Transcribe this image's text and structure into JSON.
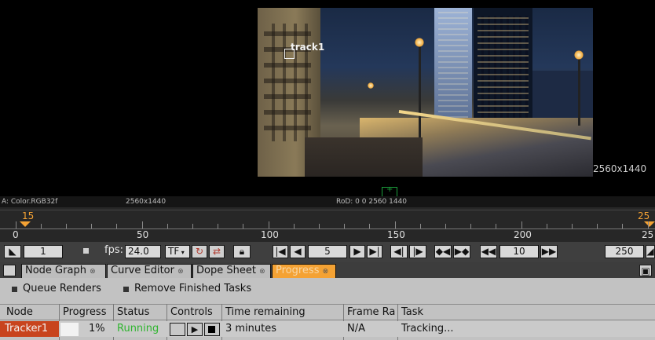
{
  "viewer": {
    "overlay_label": "track1",
    "resolution_label": "2560x1440",
    "info_left": "A: Color.RGB32f",
    "info_res": "2560x1440",
    "info_rod": "RoD: 0 0 2560 1440"
  },
  "timeline": {
    "start_marker": "15",
    "end_marker": "25",
    "ticks": [
      "0",
      "50",
      "100",
      "150",
      "200",
      "25"
    ]
  },
  "controls": {
    "first_frame": "1",
    "fps_label": "fps:",
    "fps_value": "24.0",
    "tf_label": "TF",
    "current_frame": "5",
    "increment": "10",
    "last_frame": "250"
  },
  "tabs": [
    {
      "label": "Node Graph",
      "active": false
    },
    {
      "label": "Curve Editor",
      "active": false
    },
    {
      "label": "Dope Sheet",
      "active": false
    },
    {
      "label": "Progress",
      "active": true
    }
  ],
  "progress_panel": {
    "queue_label": "Queue Renders",
    "remove_label": "Remove Finished Tasks",
    "columns": [
      "Node",
      "Progress",
      "Status",
      "Controls",
      "Time remaining",
      "Frame Ra",
      "Task"
    ],
    "rows": [
      {
        "node": "Tracker1",
        "progress": "1%",
        "status": "Running",
        "time_remaining": "3 minutes",
        "frame_rate": "N/A",
        "task": "Tracking..."
      }
    ]
  },
  "colors": {
    "accent_orange": "#f4a234",
    "node_red": "#c8441e",
    "status_green": "#2fb52f"
  }
}
